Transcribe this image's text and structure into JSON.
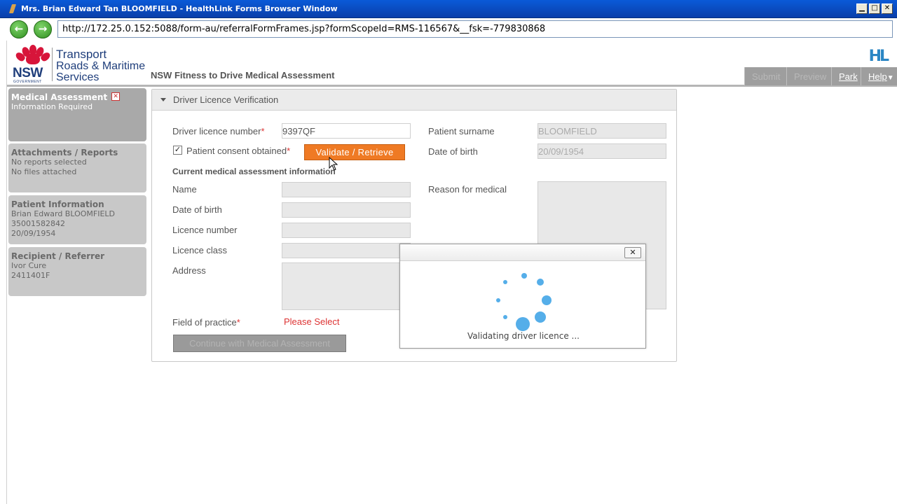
{
  "window": {
    "title": "Mrs. Brian Edward Tan BLOOMFIELD - HealthLink Forms Browser Window",
    "minimize": "▁",
    "maximize": "□",
    "close": "✕"
  },
  "address_bar": {
    "back": "←",
    "forward": "→",
    "url": "http://172.25.0.152:5088/form-au/referralFormFrames.jsp?formScopeId=RMS-116567&__fsk=-779830868"
  },
  "header": {
    "logo_nsw": "NSW",
    "logo_government": "GOVERNMENT",
    "logo_line1": "Transport",
    "logo_line2": "Roads & Maritime",
    "logo_line3": "Services",
    "page_title": "NSW Fitness to Drive Medical Assessment",
    "hl_logo": "HL",
    "buttons": {
      "submit": "Submit",
      "preview": "Preview",
      "park": "Park",
      "help": "Help",
      "help_arrow": "▼"
    }
  },
  "sidebar": {
    "items": [
      {
        "title": "Medical Assessment",
        "lines": [
          "Information Required"
        ],
        "active": true
      },
      {
        "title": "Attachments / Reports",
        "lines": [
          "No reports selected",
          "No files attached"
        ]
      },
      {
        "title": "Patient Information",
        "lines": [
          "Brian Edward BLOOMFIELD",
          "35001582842",
          "20/09/1954"
        ]
      },
      {
        "title": "Recipient / Referrer",
        "lines": [
          "Ivor Cure",
          "2411401F"
        ]
      }
    ]
  },
  "panel": {
    "heading": "Driver Licence Verification",
    "licence_number_label": "Driver licence number",
    "licence_number_value": "9397QF",
    "consent_label": "Patient consent obtained",
    "consent_checked": "✓",
    "validate_button": "Validate / Retrieve",
    "patient_surname_label": "Patient surname",
    "patient_surname_value": "BLOOMFIELD",
    "dob_label_right": "Date of birth",
    "dob_value_right": "20/09/1954",
    "current_section": "Current medical assessment information",
    "name_label": "Name",
    "dob_label": "Date of birth",
    "licence_no_label": "Licence number",
    "licence_class_label": "Licence class",
    "address_label": "Address",
    "reason_label": "Reason for medical",
    "field_of_practice_label": "Field of practice",
    "field_of_practice_value": "Please Select",
    "continue_button": "Continue with Medical Assessment",
    "required_marker": "*"
  },
  "modal": {
    "close": "✕",
    "message": "Validating driver licence ..."
  },
  "colors": {
    "accent_orange": "#ef7a24",
    "spinner_blue": "#55aee9",
    "title_blue": "#0a5ad8",
    "required_red": "#dd3333"
  }
}
